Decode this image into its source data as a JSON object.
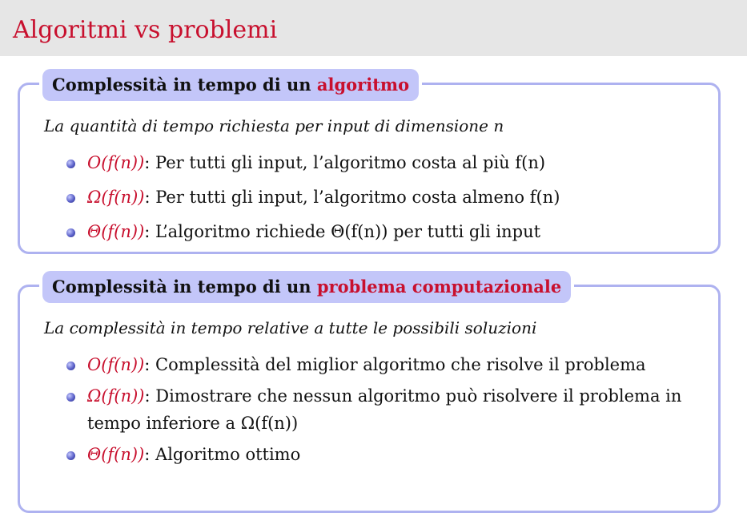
{
  "header": {
    "title": "Algoritmi vs problemi"
  },
  "box1": {
    "title_prefix": "Complessità in tempo di un ",
    "title_highlight": "algoritmo",
    "lead": "La quantità di tempo richiesta per input di dimensione n",
    "items": [
      {
        "symbol": "O(f(n))",
        "text": ": Per tutti gli input, l’algoritmo costa al più f(n)"
      },
      {
        "symbol": "Ω(f(n))",
        "text": ": Per tutti gli input, l’algoritmo costa almeno f(n)"
      },
      {
        "symbol": "Θ(f(n))",
        "text": ": L’algoritmo richiede Θ(f(n)) per tutti gli input"
      }
    ]
  },
  "box2": {
    "title_prefix": "Complessità in tempo di un ",
    "title_highlight": "problema computazionale",
    "lead": "La complessità in tempo relative a tutte le possibili soluzioni",
    "items": [
      {
        "symbol": "O(f(n))",
        "text": ": Complessità del miglior algoritmo che risolve il problema"
      },
      {
        "symbol": "Ω(f(n))",
        "text": ": Dimostrare che nessun algoritmo può risolvere il problema in tempo inferiore a Ω(f(n))"
      },
      {
        "symbol": "Θ(f(n))",
        "text": ": Algoritmo ottimo"
      }
    ]
  }
}
